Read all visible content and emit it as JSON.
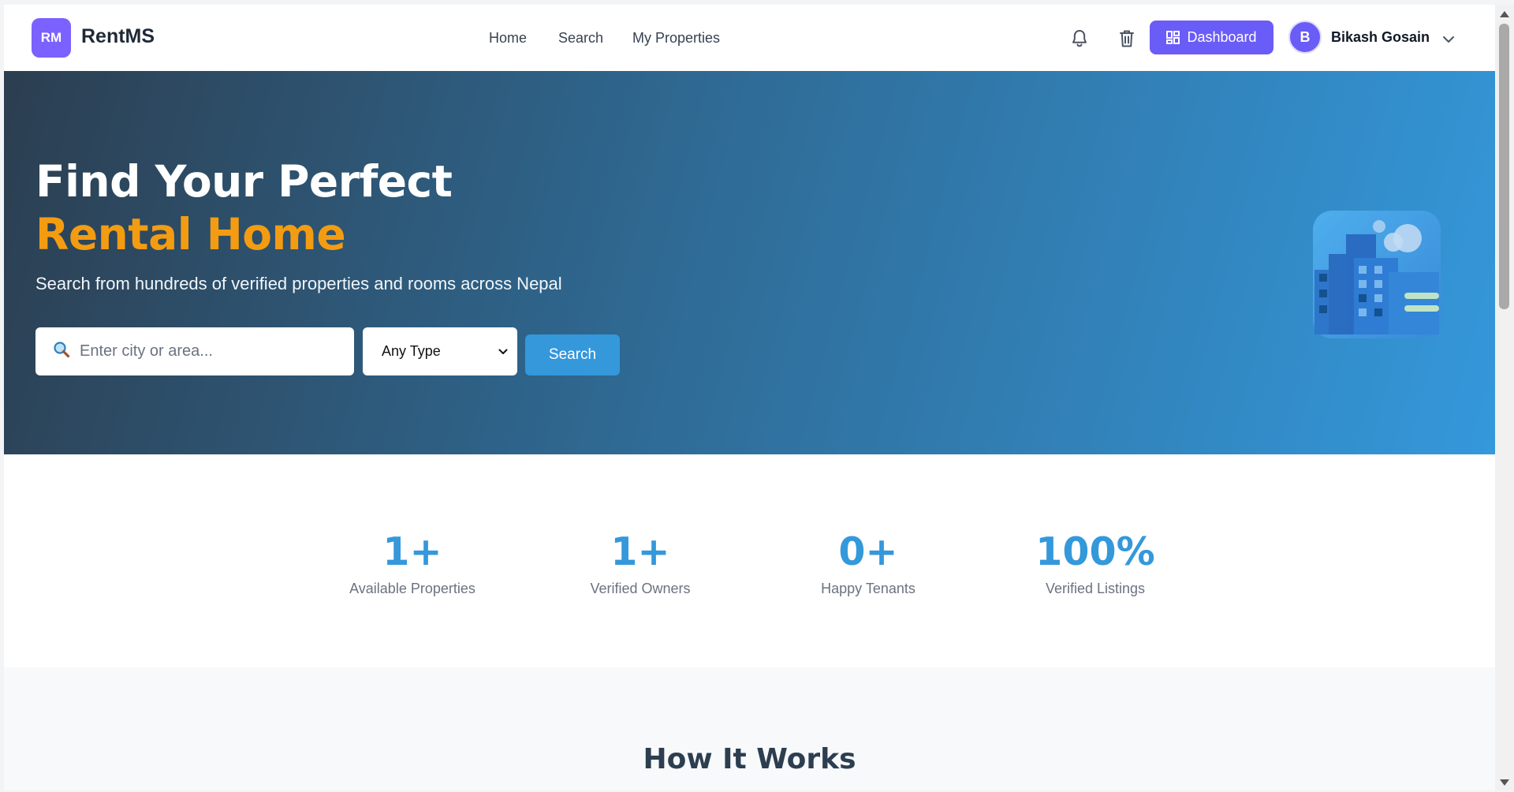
{
  "header": {
    "logo_badge": "RM",
    "brand": "RentMS",
    "nav": [
      {
        "label": "Home"
      },
      {
        "label": "Search"
      },
      {
        "label": "My Properties"
      }
    ],
    "dashboard_label": "Dashboard",
    "user_initial": "B",
    "user_name": "Bikash Gosain",
    "icons": [
      "bell-icon",
      "trash-icon",
      "grid-icon",
      "chevron-down-icon"
    ]
  },
  "hero": {
    "title_line1": "Find Your Perfect",
    "title_line2": "Rental Home",
    "subtitle": "Search from hundreds of verified properties and rooms across Nepal",
    "search_placeholder": "Enter city or area...",
    "search_value": "",
    "type_selected": "Any Type",
    "search_button": "Search",
    "colors": {
      "accent": "#f39c12",
      "gradient_start": "#2c3e50",
      "gradient_end": "#3498db"
    }
  },
  "stats": [
    {
      "value": "1+",
      "label": "Available Properties"
    },
    {
      "value": "1+",
      "label": "Verified Owners"
    },
    {
      "value": "0+",
      "label": "Happy Tenants"
    },
    {
      "value": "100%",
      "label": "Verified Listings"
    }
  ],
  "how_it_works": {
    "title": "How It Works"
  },
  "colors": {
    "primary": "#6a5cf6",
    "stat_blue": "#3498db",
    "heading_dark": "#2c3e50"
  }
}
